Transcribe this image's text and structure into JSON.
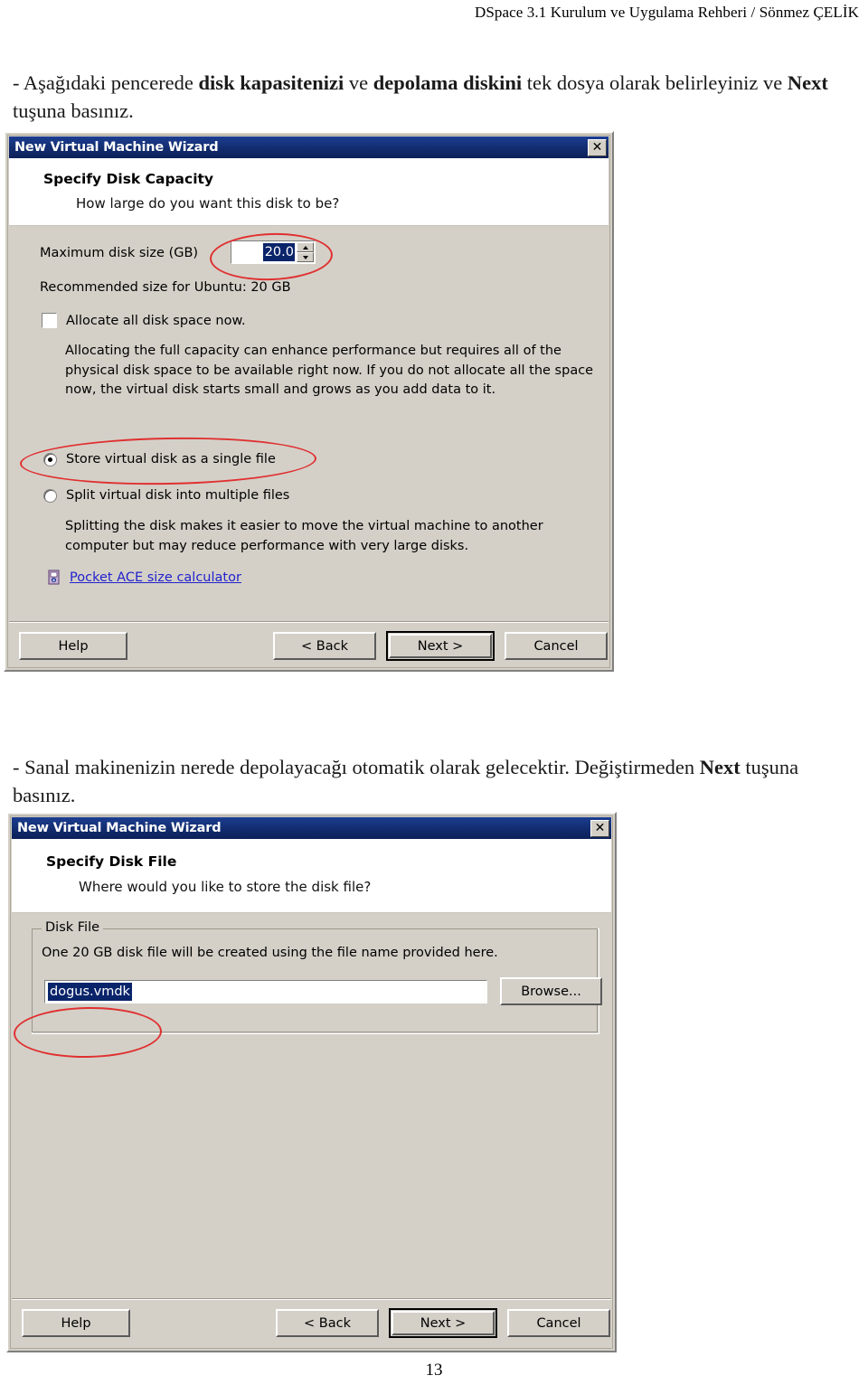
{
  "document": {
    "header": "DSpace 3.1  Kurulum ve Uygulama Rehberi / Sönmez ÇELİK",
    "page_number": "13",
    "paragraph_1_prefix": "- Aşağıdaki pencerede ",
    "paragraph_1_bold_1": "disk kapasitenizi",
    "paragraph_1_mid_1": " ve ",
    "paragraph_1_bold_2": "depolama diskini",
    "paragraph_1_mid_2": " tek dosya olarak belirleyiniz  ve ",
    "paragraph_1_bold_3": "Next",
    "paragraph_1_suffix": " tuşuna basınız.",
    "paragraph_2_prefix": "- Sanal makinenizin nerede depolayacağı otomatik olarak gelecektir. Değiştirmeden ",
    "paragraph_2_bold_1": "Next",
    "paragraph_2_suffix": " tuşuna basınız."
  },
  "dialog1": {
    "title": "New Virtual Machine Wizard",
    "close_label": "✕",
    "heading": "Specify Disk Capacity",
    "subheading": "How large do you want this disk to be?",
    "max_disk_size_label": "Maximum disk size (GB)",
    "max_disk_size_value": "20.0",
    "recommended_text": "Recommended size for Ubuntu: 20 GB",
    "allocate_checkbox_label": "Allocate all disk space now.",
    "allocate_checkbox_checked": false,
    "allocate_description": "Allocating the full capacity can enhance performance but requires all of the physical disk space to be available right now. If you do not allocate all the space now, the virtual disk starts small and grows as you add data to it.",
    "radio_single_label": "Store virtual disk as a single file",
    "radio_split_label": "Split virtual disk into multiple files",
    "radio_selected": "single",
    "split_description": "Splitting the disk makes it easier to move the virtual machine to another computer but may reduce performance with very large disks.",
    "link_label": "Pocket ACE size calculator",
    "buttons": {
      "help": "Help",
      "back": "< Back",
      "next": "Next >",
      "cancel": "Cancel"
    }
  },
  "dialog2": {
    "title": "New Virtual Machine Wizard",
    "close_label": "✕",
    "heading": "Specify Disk File",
    "subheading": "Where would you like to store the disk file?",
    "groupbox_title": "Disk File",
    "groupbox_description": "One 20 GB disk file will be created using the file name provided here.",
    "filename_value": "dogus.vmdk",
    "browse_label": "Browse...",
    "buttons": {
      "help": "Help",
      "back": "< Back",
      "next": "Next >",
      "cancel": "Cancel"
    }
  },
  "colors": {
    "titlebar": "#12306e",
    "dialog_face": "#d4d0c8",
    "selection": "#0a246a",
    "link": "#2222cc",
    "annotation": "#e03030"
  }
}
